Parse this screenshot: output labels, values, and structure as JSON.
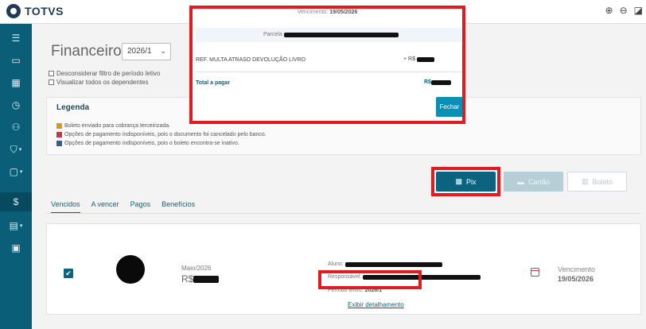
{
  "app": {
    "logo_text": "TOTVS"
  },
  "topbar": {
    "icons": [
      "zoom-in-icon",
      "zoom-out-icon",
      "fullscreen-icon"
    ],
    "zoom_in_glyph": "⊕",
    "zoom_out_glyph": "⊖",
    "fullscreen_glyph": "◪"
  },
  "sidebar": {
    "items": [
      {
        "icon": "menu-icon",
        "glyph": "☰"
      },
      {
        "icon": "monitor-icon",
        "glyph": "▭"
      },
      {
        "icon": "grid-icon",
        "glyph": "▦"
      },
      {
        "icon": "clock-icon",
        "glyph": "◷"
      },
      {
        "icon": "user-add-icon",
        "glyph": "⚇"
      },
      {
        "icon": "graduation-icon",
        "glyph": "⛉"
      },
      {
        "icon": "clipboard-icon",
        "glyph": "▢"
      },
      {
        "icon": "dollar-icon",
        "glyph": "$"
      },
      {
        "icon": "laptop-icon",
        "glyph": "▤"
      },
      {
        "icon": "document-icon",
        "glyph": "▣"
      }
    ]
  },
  "main": {
    "title": "Financeiro:",
    "period_value": "2026/1",
    "checkboxes": [
      "Desconsiderar filtro de período letivo",
      "Visualizar todos os dependentes"
    ],
    "legend": {
      "title": "Legenda",
      "items": [
        {
          "color": "#d99a1c",
          "text": "Boleto enviado para cobrança terceirizada."
        },
        {
          "color": "#c0394b",
          "text": "Opções de pagamento indisponíveis, pois o documento foi cancelado pelo banco."
        },
        {
          "color": "#2f5f9e",
          "text": "Opções de pagamento indisponíveis, pois o boleto encontra-se inativo."
        }
      ]
    },
    "buttons": {
      "pix": "Pix",
      "cartao": "Cartão",
      "boleto": "Boleto"
    },
    "tabs": [
      "Vencidos",
      "A vencer",
      "Pagos",
      "Benefícios"
    ],
    "card": {
      "month": "Maio/2026",
      "currency": "R$",
      "aluno_label": "Aluno:",
      "responsavel_label": "Responsável:",
      "periodo_label": "Período letivo:",
      "periodo_value": "2026/1",
      "detail_link": "Exibir detalhamento",
      "vencimento_label": "Vencimento",
      "vencimento_date": "19/05/2026"
    }
  },
  "modal": {
    "vencimento_label": "Vencimento:",
    "vencimento_date": "19/05/2026",
    "parcela_label": "Parcela",
    "ref_item": "REF. MULTA ATRASO DEVOLUÇÃO LIVRO",
    "ref_prefix": "+ R$",
    "total_label": "Total a pagar",
    "total_currency": "R$",
    "close_button": "Fechar"
  },
  "colors": {
    "sidebar": "#0b5e78",
    "accent": "#0c6380",
    "highlight": "#e11b22"
  }
}
